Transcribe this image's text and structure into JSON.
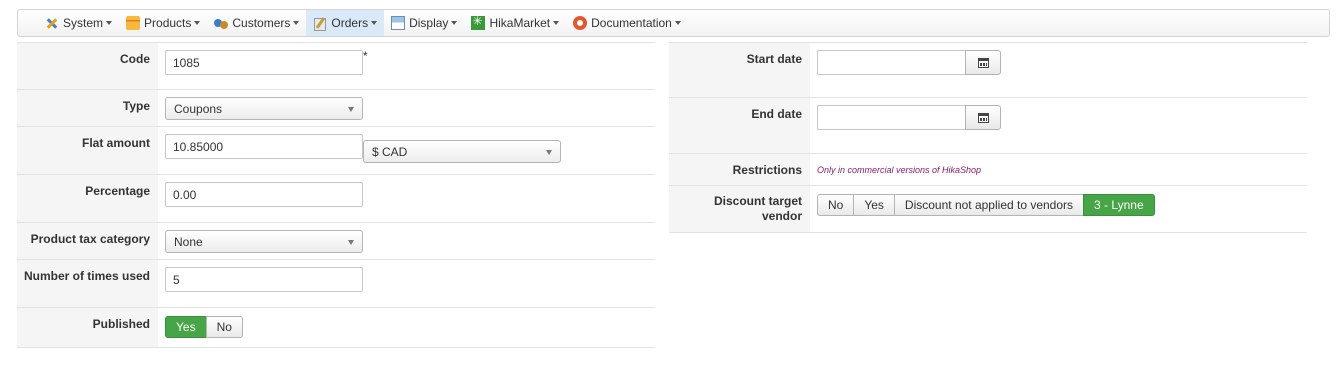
{
  "menu": {
    "items": [
      {
        "label": "System",
        "icon": "tools-icon"
      },
      {
        "label": "Products",
        "icon": "products-icon"
      },
      {
        "label": "Customers",
        "icon": "customers-icon"
      },
      {
        "label": "Orders",
        "icon": "orders-icon",
        "active": true
      },
      {
        "label": "Display",
        "icon": "display-icon"
      },
      {
        "label": "HikaMarket",
        "icon": "hikamarket-icon"
      },
      {
        "label": "Documentation",
        "icon": "lifebuoy-icon"
      }
    ]
  },
  "form": {
    "code": {
      "label": "Code",
      "value": "1085",
      "required_mark": "*"
    },
    "type": {
      "label": "Type",
      "value": "Coupons"
    },
    "flat_amount": {
      "label": "Flat amount",
      "value": "10.85000",
      "currency": "$ CAD"
    },
    "percentage": {
      "label": "Percentage",
      "value": "0.00"
    },
    "tax_category": {
      "label": "Product tax category",
      "value": "None"
    },
    "times_used": {
      "label": "Number of times used",
      "value": "5"
    },
    "published": {
      "label": "Published",
      "yes": "Yes",
      "no": "No",
      "selected": "Yes"
    },
    "start_date": {
      "label": "Start date",
      "value": ""
    },
    "end_date": {
      "label": "End date",
      "value": ""
    },
    "restrictions": {
      "label": "Restrictions",
      "text": "Only in commercial versions of HikaShop"
    },
    "target_vendor": {
      "label_line1": "Discount target",
      "label_line2": "vendor",
      "options": [
        "No",
        "Yes",
        "Discount not applied to vendors",
        "3 - Lynne"
      ],
      "selected": "3 - Lynne"
    }
  },
  "colors": {
    "accent_green": "#46a546",
    "active_menu": "#d9e9f7",
    "restriction_text": "#8a1b6e"
  }
}
